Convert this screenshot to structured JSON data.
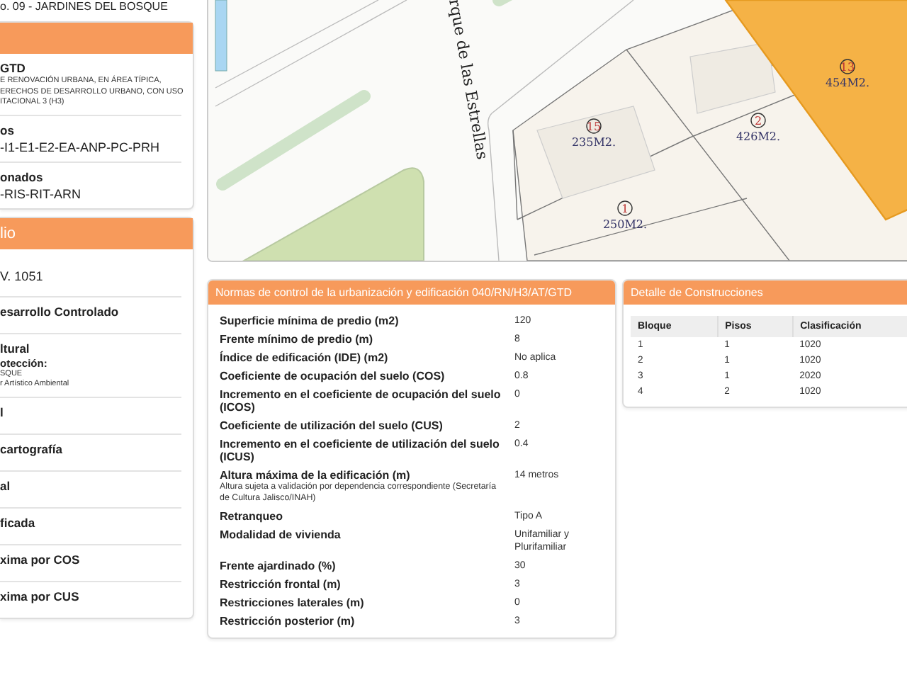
{
  "location_line": "o. 09 - JARDINES DEL BOSQUE",
  "zoning_card": {
    "sections": [
      {
        "title": "GTD",
        "notes": [
          "E RENOVACIÓN URBANA, EN ÁREA TÍPICA,",
          "ERECHOS DE DESARROLLO URBANO, CON USO",
          "ITACIONAL 3 (H3)"
        ]
      },
      {
        "title": "os",
        "value": "-I1-E1-E2-EA-ANP-PC-PRH"
      },
      {
        "title": "onados",
        "value": "-RIS-RIT-ARN"
      }
    ]
  },
  "property_card": {
    "header": "lio",
    "items": [
      {
        "value": "V. 1051"
      },
      {
        "title": "esarrollo Controlado"
      },
      {
        "title": "ltural",
        "subtitle": "otección:",
        "notes": [
          "SQUE",
          "r Artístico Ambiental"
        ]
      },
      {
        "title": "l"
      },
      {
        "title": "cartografía"
      },
      {
        "title": "al"
      },
      {
        "title": "ficada"
      },
      {
        "title": "xima por COS"
      },
      {
        "title": "xima por CUS"
      }
    ]
  },
  "map": {
    "street": "rque de las Estrellas",
    "lots": [
      {
        "number": "15",
        "area": "235M2."
      },
      {
        "number": "2",
        "area": "426M2."
      },
      {
        "number": "13",
        "area": "454M2."
      },
      {
        "number": "1",
        "area": "250M2."
      }
    ]
  },
  "norms": {
    "title": "Normas de control de la urbanización y edificación 040/RN/H3/AT/GTD",
    "rows": [
      {
        "label": "Superficie mínima de predio (m2)",
        "value": "120"
      },
      {
        "label": "Frente mínimo de predio (m)",
        "value": "8"
      },
      {
        "label": "Índice de edificación (IDE) (m2)",
        "value": "No aplica"
      },
      {
        "label": "Coeficiente de ocupación del suelo (COS)",
        "value": "0.8"
      },
      {
        "label": "Incremento en el coeficiente de ocupación del suelo (ICOS)",
        "value": "0"
      },
      {
        "label": "Coeficiente de utilización del suelo (CUS)",
        "value": "2"
      },
      {
        "label": "Incremento en el coeficiente de utilización del suelo (ICUS)",
        "value": "0.4"
      },
      {
        "label": "Altura máxima de la edificación (m)",
        "note": "Altura sujeta a validación por dependencia correspondiente (Secretaría de Cultura Jalisco/INAH)",
        "value": "14 metros"
      },
      {
        "label": "Retranqueo",
        "value": "Tipo A"
      },
      {
        "label": "Modalidad de vivienda",
        "value": "Unifamiliar y Plurifamiliar"
      },
      {
        "label": "Frente ajardinado (%)",
        "value": "30"
      },
      {
        "label": "Restricción frontal (m)",
        "value": "3"
      },
      {
        "label": "Restricciones laterales (m)",
        "value": "0"
      },
      {
        "label": "Restricción posterior (m)",
        "value": "3"
      }
    ]
  },
  "constructions": {
    "title": "Detalle de Construcciones",
    "columns": [
      "Bloque",
      "Pisos",
      "Clasificación"
    ],
    "rows": [
      [
        "1",
        "1",
        "1020"
      ],
      [
        "2",
        "1",
        "1020"
      ],
      [
        "3",
        "1",
        "2020"
      ],
      [
        "4",
        "2",
        "1020"
      ]
    ]
  }
}
